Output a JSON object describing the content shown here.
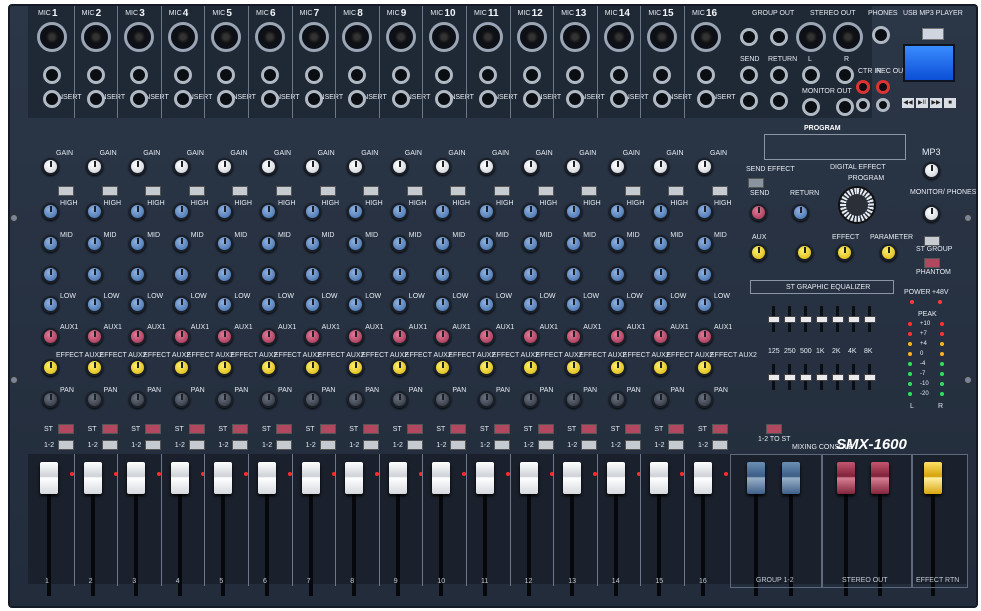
{
  "colors": {
    "panel": "#28323f",
    "gain": "#ffffff",
    "eq": "#4f7dbb",
    "aux": "#b33b5c",
    "effect": "#f1c40f",
    "pan": "#3b414b"
  },
  "channels": [
    "1",
    "2",
    "3",
    "4",
    "5",
    "6",
    "7",
    "8",
    "9",
    "10",
    "11",
    "12",
    "13",
    "14",
    "15",
    "16"
  ],
  "labels": {
    "mic": "MIC",
    "insert": "INSERT",
    "gain": "GAIN",
    "high": "HIGH",
    "mid": "MID",
    "low": "LOW",
    "aux1": "AUX1",
    "effect_aux2": "EFFECT AUX2",
    "pan": "PAN",
    "st": "ST",
    "one_two": "1-2",
    "group_out": "GROUP OUT",
    "send": "SEND",
    "return": "RETURN",
    "stereo_out": "STEREO OUT",
    "phones": "PHONES",
    "usb_mp3_player": "USB MP3 PLAYER",
    "ctr_in": "CTR IN",
    "rec_out": "REC OUT",
    "monitor_out": "MONITOR OUT",
    "program": "PROGRAM",
    "digital_effect": "DIGITAL EFFECT",
    "mp3": "MP3",
    "send_effect": "SEND EFFECT",
    "aux_knob": "AUX",
    "effect_knob": "EFFECT",
    "parameter": "PARAMETER",
    "monitor_phones": "MONITOR/ PHONES",
    "st_group": "ST GROUP",
    "phantom": "PHANTOM",
    "graphic_eq": "ST GRAPHIC EQUALIZER",
    "power": "POWER",
    "plus48v": "+48V",
    "peak": "PEAK",
    "one_two_to_st": "1-2 TO ST",
    "mixing_console": "MIXING CONSOLE",
    "model": "SMX-1600",
    "group_12": "GROUP 1-2",
    "stereo_out_section": "STEREO OUT",
    "effect_rtn": "EFFECT RTN",
    "l": "L",
    "r": "R"
  },
  "eq_bands": [
    "125",
    "250",
    "500",
    "1K",
    "2K",
    "4K",
    "8K"
  ],
  "meter_scale": [
    "+10",
    "+7",
    "+4",
    "0",
    "-4",
    "-7",
    "-10",
    "-20"
  ],
  "usb_display": "",
  "transport": [
    "◀◀",
    "▶II",
    "▶▶",
    "■"
  ]
}
